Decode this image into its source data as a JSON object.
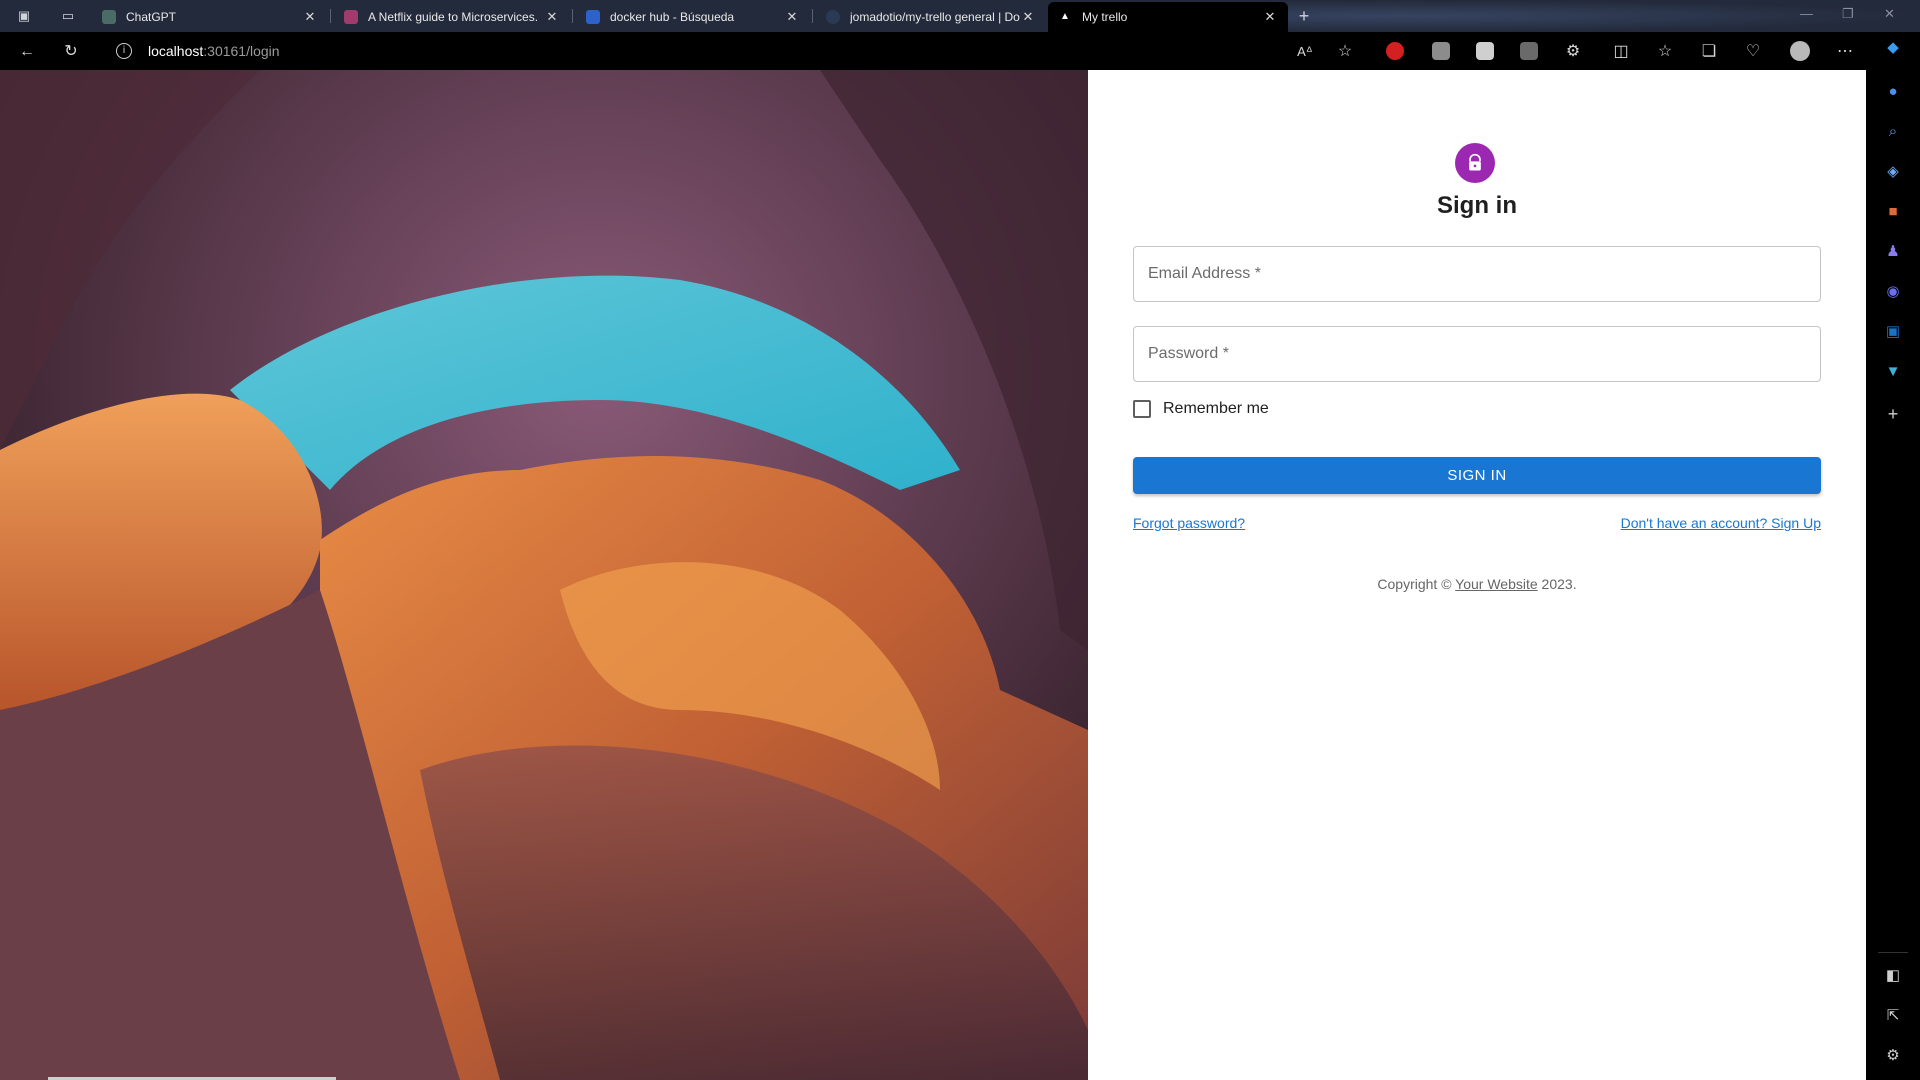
{
  "browser": {
    "tabs": [
      {
        "title": "ChatGPT",
        "favicon_color": "#4a6b66"
      },
      {
        "title": "A Netflix guide to Microservices.",
        "favicon_color": "#a33a6e"
      },
      {
        "title": "docker hub - Búsqueda",
        "favicon_color": "#2c62c9"
      },
      {
        "title": "jomadotio/my-trello general | Do",
        "favicon_color": "#2a3a55"
      },
      {
        "title": "My trello",
        "favicon_color": "#ffffff"
      }
    ],
    "url_host": "localhost",
    "url_path": ":30161/login",
    "colors": {
      "tabstrip": "#232a3b",
      "toolbar": "#000000"
    }
  },
  "login": {
    "icon": "lock-icon",
    "title": "Sign in",
    "email_placeholder": "Email Address *",
    "password_placeholder": "Password *",
    "remember_label": "Remember me",
    "signin_label": "SIGN IN",
    "forgot_link": "Forgot password?",
    "signup_link": "Don't have an account? Sign Up",
    "copyright_prefix": "Copyright © ",
    "copyright_link": "Your Website",
    "copyright_suffix": " 2023.",
    "colors": {
      "primary": "#1976d2",
      "avatar": "#9c27b0"
    }
  }
}
